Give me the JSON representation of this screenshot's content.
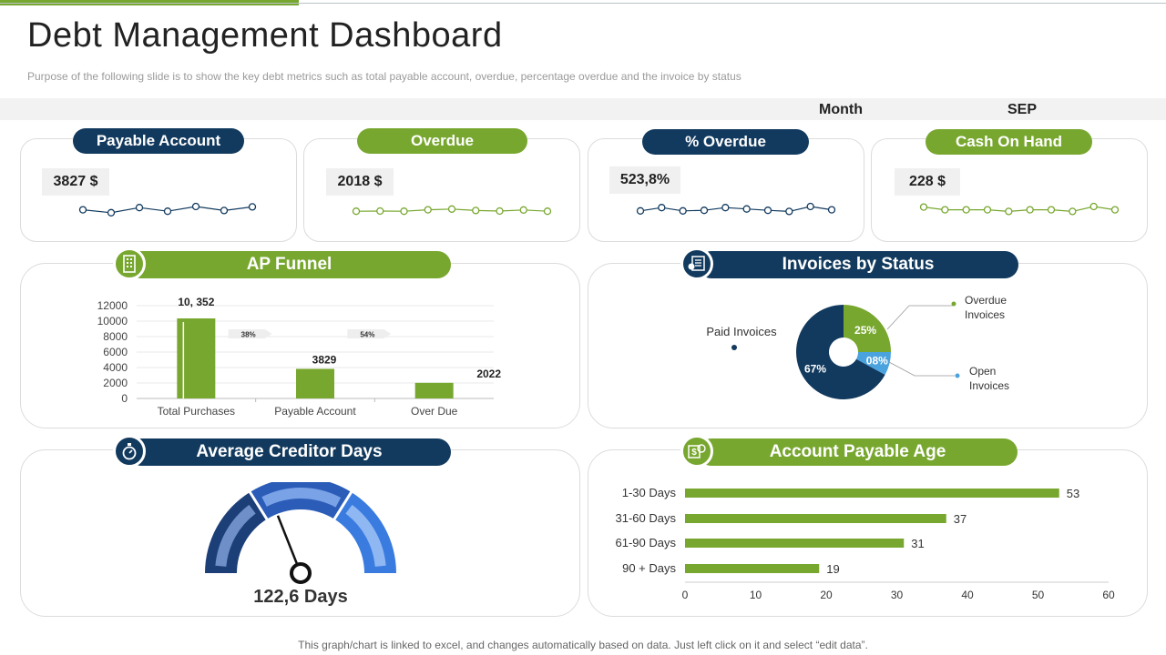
{
  "header": {
    "title": "Debt Management Dashboard",
    "subtitle": "Purpose of the following slide is to show the key debt metrics such as total payable account, overdue,  percentage overdue  and the invoice  by status",
    "month_label": "Month",
    "month_value": "SEP"
  },
  "colors": {
    "navy": "#123a5e",
    "green": "#78a72f",
    "light_blue": "#4aa3df"
  },
  "kpis": [
    {
      "label": "Payable Account",
      "value": "3827 $",
      "color": "navy",
      "spark": [
        0.55,
        0.15,
        0.85,
        0.35,
        1.0,
        0.45,
        0.95
      ]
    },
    {
      "label": "Overdue",
      "value": "2018 $",
      "color": "green",
      "spark": [
        0.2,
        0.25,
        0.2,
        0.6,
        0.8,
        0.4,
        0.25,
        0.55,
        0.2
      ]
    },
    {
      "label": "% Overdue",
      "value": "523,8%",
      "color": "navy",
      "spark": [
        0.2,
        0.8,
        0.2,
        0.3,
        0.8,
        0.55,
        0.3,
        0.1,
        1.0,
        0.4
      ]
    },
    {
      "label": "Cash On Hand",
      "value": "228 $",
      "color": "green",
      "spark": [
        0.9,
        0.4,
        0.4,
        0.4,
        0.1,
        0.4,
        0.4,
        0.1,
        1.0,
        0.4
      ]
    }
  ],
  "sections": {
    "ap_funnel": "AP Funnel",
    "invoices_by_status": "Invoices by Status",
    "avg_creditor_days": "Average Creditor Days",
    "account_payable_age": "Account Payable Age"
  },
  "ap_funnel": {
    "chart_data": {
      "type": "bar",
      "categories": [
        "Total Purchases",
        "Payable Account",
        "Over Due"
      ],
      "values": [
        10352,
        3829,
        2022
      ],
      "data_labels": [
        "10, 352",
        "3829",
        "2022"
      ],
      "y_ticks": [
        "0",
        "2000",
        "4000",
        "6000",
        "8000",
        "10000",
        "12000"
      ],
      "ylim": [
        0,
        12000
      ],
      "conversion_labels": [
        "38%",
        "54%"
      ],
      "color": "#78a72f"
    }
  },
  "invoices": {
    "chart_data": {
      "type": "pie",
      "slices": [
        {
          "name": "Paid Invoices",
          "value": 67,
          "label": "67%",
          "color": "#123a5e"
        },
        {
          "name": "Overdue Invoices",
          "value": 25,
          "label": "25%",
          "color": "#78a72f"
        },
        {
          "name": "Open Invoices",
          "value": 8,
          "label": "08%",
          "color": "#4aa3df"
        }
      ],
      "legend": {
        "paid": "Paid Invoices",
        "overdue_1": "Overdue",
        "overdue_2": "Invoices",
        "open_1": "Open",
        "open_2": "Invoices"
      }
    }
  },
  "gauge": {
    "value_text": "122,6 Days",
    "needle_fraction": 0.38
  },
  "ap_age": {
    "chart_data": {
      "type": "bar",
      "orientation": "horizontal",
      "categories": [
        "1-30 Days",
        "31-60 Days",
        "61-90 Days",
        "90 + Days"
      ],
      "values": [
        53,
        37,
        31,
        19
      ],
      "x_ticks": [
        "0",
        "10",
        "20",
        "30",
        "40",
        "50",
        "60"
      ],
      "xlim": [
        0,
        60
      ],
      "color": "#78a72f"
    }
  },
  "footer": "This graph/chart is linked to excel, and changes automatically based on data. Just left click on it and select “edit data”."
}
